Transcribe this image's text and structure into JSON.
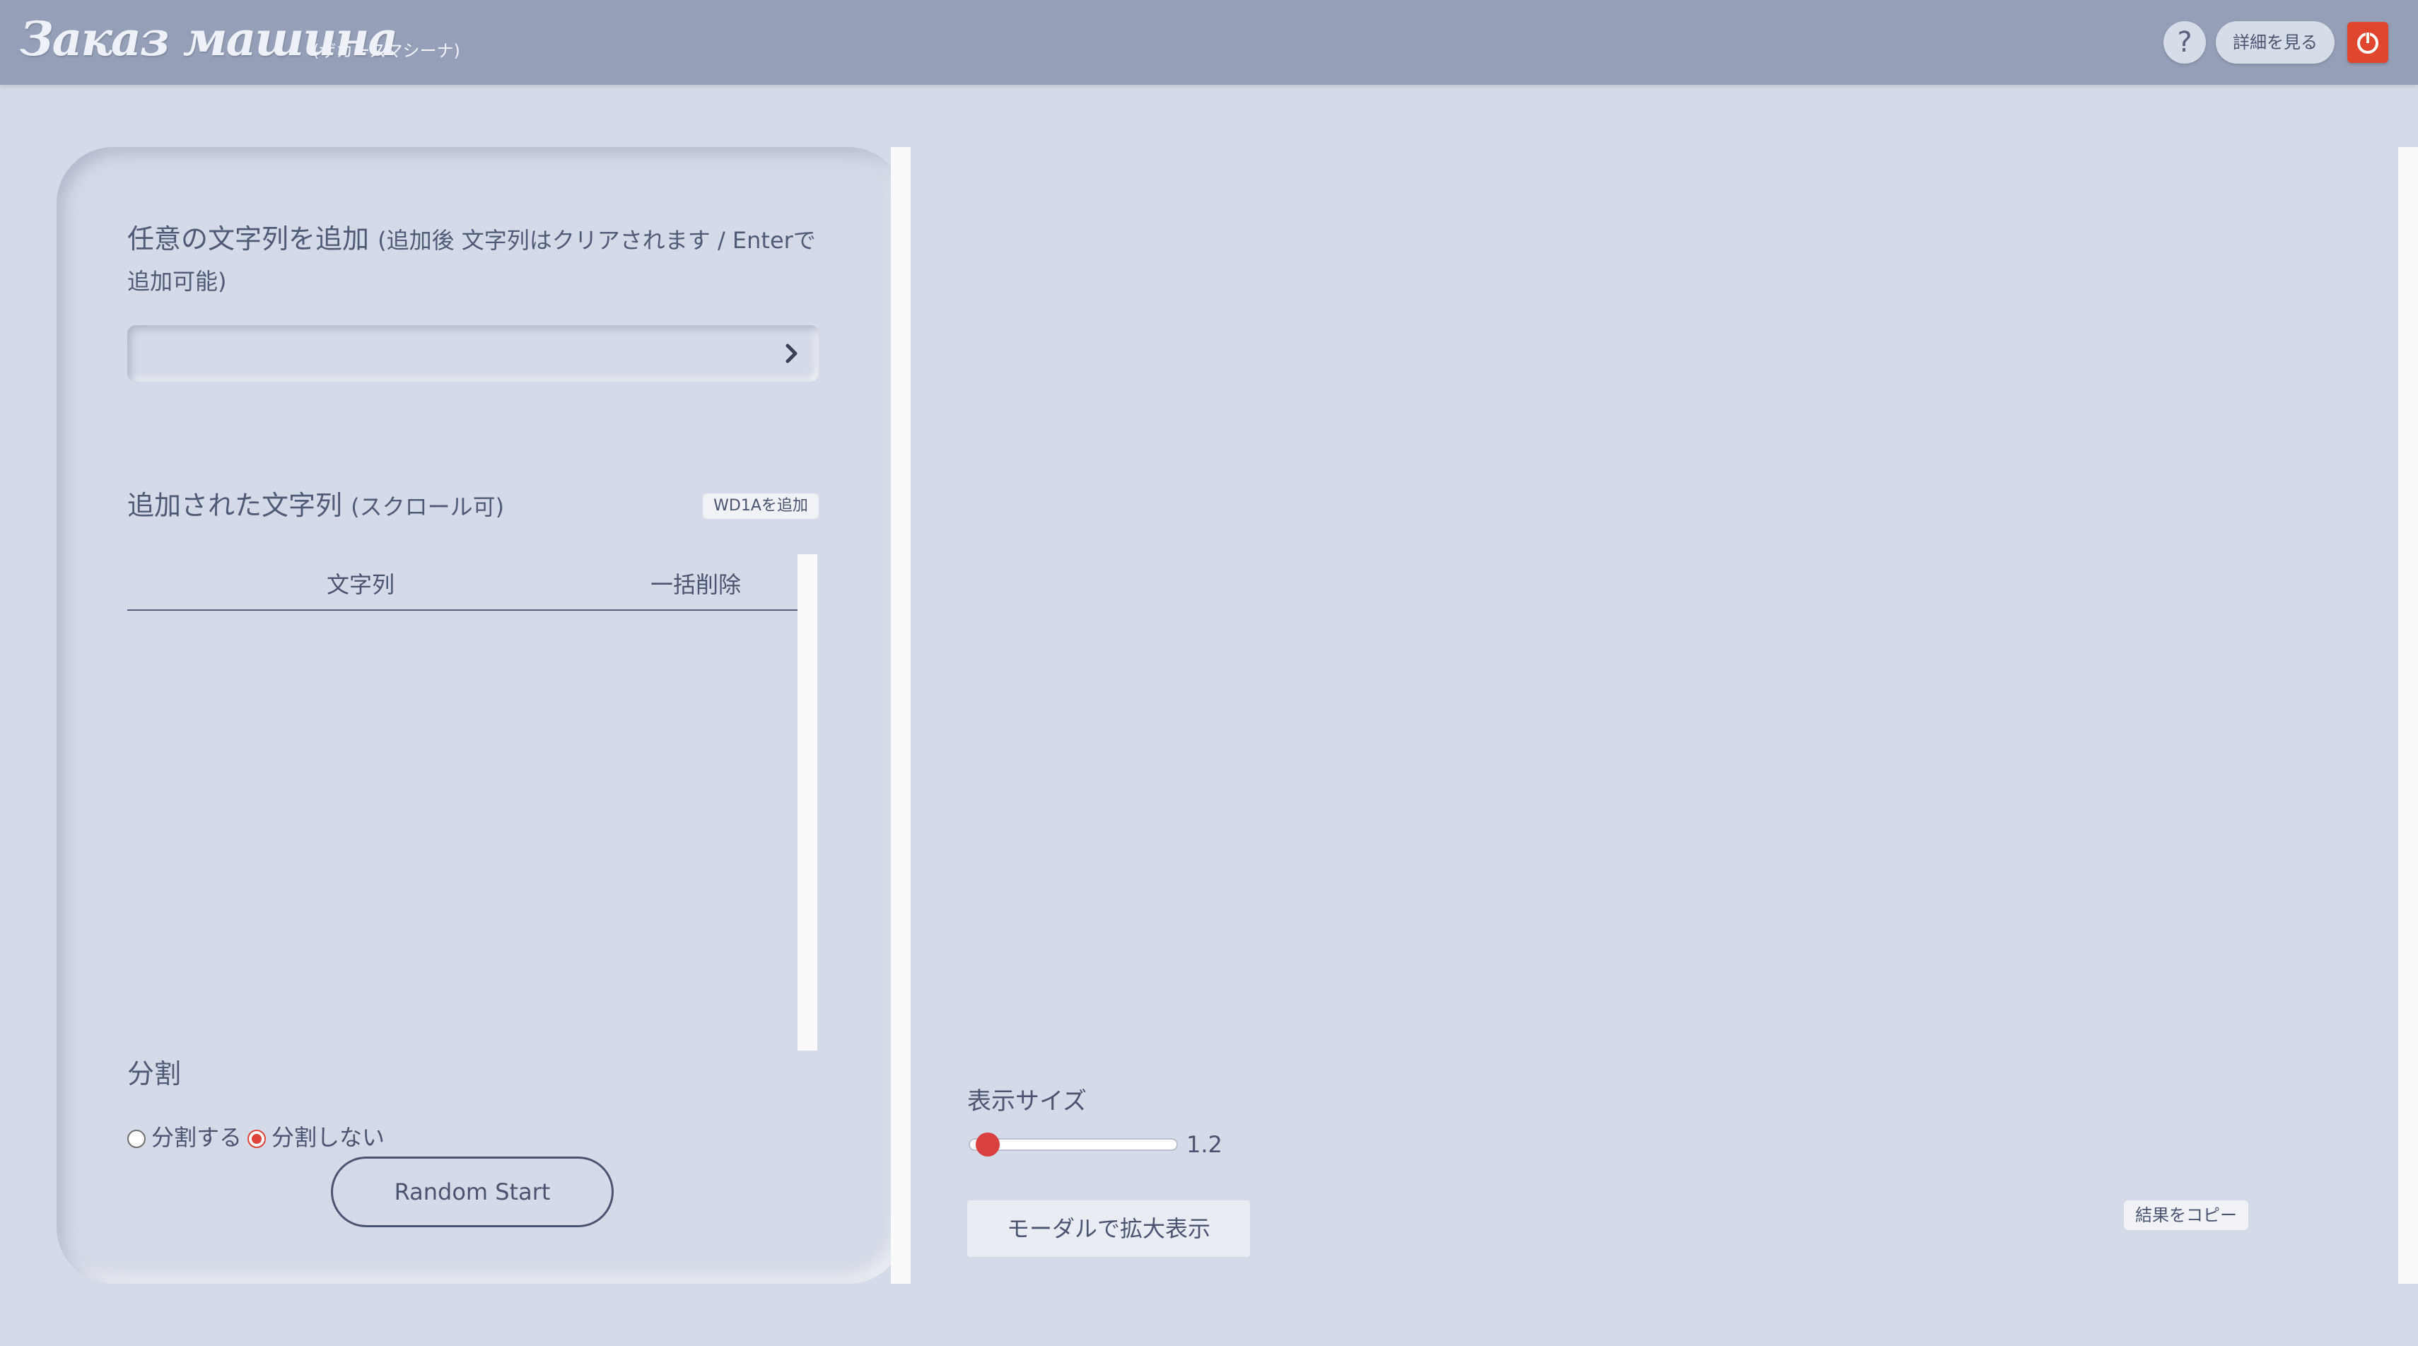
{
  "header": {
    "logo": "Заказ машина",
    "logo_sub": "(ザカースマシーナ)",
    "help_label": "?",
    "detail_label": "詳細を見る",
    "power_icon": "power-icon",
    "accent_color": "#e0452e"
  },
  "add_section": {
    "title": "任意の文字列を追加",
    "note": "(追加後 文字列はクリアされます / Enterで追加可能)",
    "input_value": "",
    "input_placeholder": "",
    "submit_icon": "chevron-right-icon"
  },
  "list_section": {
    "title": "追加された文字列",
    "note": "(スクロール可)",
    "wd_button": "WD1Aを追加",
    "columns": [
      "文字列",
      "一括削除"
    ],
    "rows": []
  },
  "split_section": {
    "title": "分割",
    "options": [
      {
        "label": "分割する",
        "checked": false
      },
      {
        "label": "分割しない",
        "checked": true
      }
    ]
  },
  "random_button": "Random Start",
  "display": {
    "size_label": "表示サイズ",
    "size_value": "1.2",
    "slider_fraction": 0.03,
    "modal_button": "モーダルで拡大表示",
    "copy_button": "結果をコピー"
  }
}
